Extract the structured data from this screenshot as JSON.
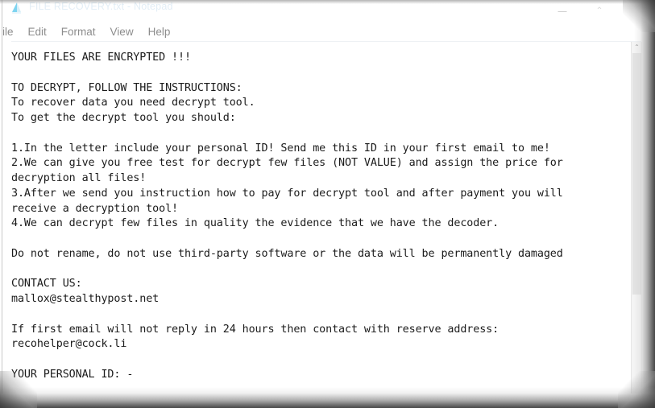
{
  "window": {
    "title": "FILE RECOVERY.txt - Notepad",
    "app_icon": "notepad-icon",
    "controls": {
      "minimize_label": "–",
      "maximize_label": "⌃",
      "close_label": ""
    }
  },
  "menu": {
    "items": [
      {
        "label": "ile",
        "name": "file"
      },
      {
        "label": "Edit",
        "name": "edit"
      },
      {
        "label": "Format",
        "name": "format"
      },
      {
        "label": "View",
        "name": "view"
      },
      {
        "label": "Help",
        "name": "help"
      }
    ]
  },
  "scrollbar": {
    "up_arrow_glyph": "⌃"
  },
  "document": {
    "heading": "YOUR FILES ARE ENCRYPTED !!!",
    "instructions_header": "TO DECRYPT, FOLLOW THE INSTRUCTIONS:",
    "line_recover": "To recover data you need decrypt tool.",
    "line_get": "To get the decrypt tool you should:",
    "step1": "1.In the letter include your personal ID! Send me this ID in your first email to me!",
    "step2": "2.We can give you free test for decrypt few files (NOT VALUE) and assign the price for decryption all files!",
    "step3": "3.After we send you instruction how to pay for decrypt tool and after payment you will receive a decryption tool!",
    "step4": "4.We can decrypt few files in quality the evidence that we have the decoder.",
    "warning": "Do not rename, do not use third-party software or the data will be permanently damaged",
    "contact_header": "CONTACT US:",
    "email_primary": "mallox@stealthypost.net",
    "reserve_note": "If first email will not reply in 24 hours then contact with reserve address:",
    "email_reserve": "recohelper@cock.li",
    "personal_id_label": "YOUR PERSONAL ID: -",
    "body": "YOUR FILES ARE ENCRYPTED !!!\n\nTO DECRYPT, FOLLOW THE INSTRUCTIONS:\nTo recover data you need decrypt tool.\nTo get the decrypt tool you should:\n\n1.In the letter include your personal ID! Send me this ID in your first email to me!\n2.We can give you free test for decrypt few files (NOT VALUE) and assign the price for\ndecryption all files!\n3.After we send you instruction how to pay for decrypt tool and after payment you will\nreceive a decryption tool!\n4.We can decrypt few files in quality the evidence that we have the decoder.\n\nDo not rename, do not use third-party software or the data will be permanently damaged\n\nCONTACT US:\nmallox@stealthypost.net\n\nIf first email will not reply in 24 hours then contact with reserve address:\nrecohelper@cock.li\n\nYOUR PERSONAL ID: -"
  },
  "colors": {
    "text": "#1b1b1b",
    "menu_text": "#8d8d8d",
    "title_text": "#e3eef6",
    "background": "#ffffff",
    "icon_accent": "#29b6e8"
  }
}
